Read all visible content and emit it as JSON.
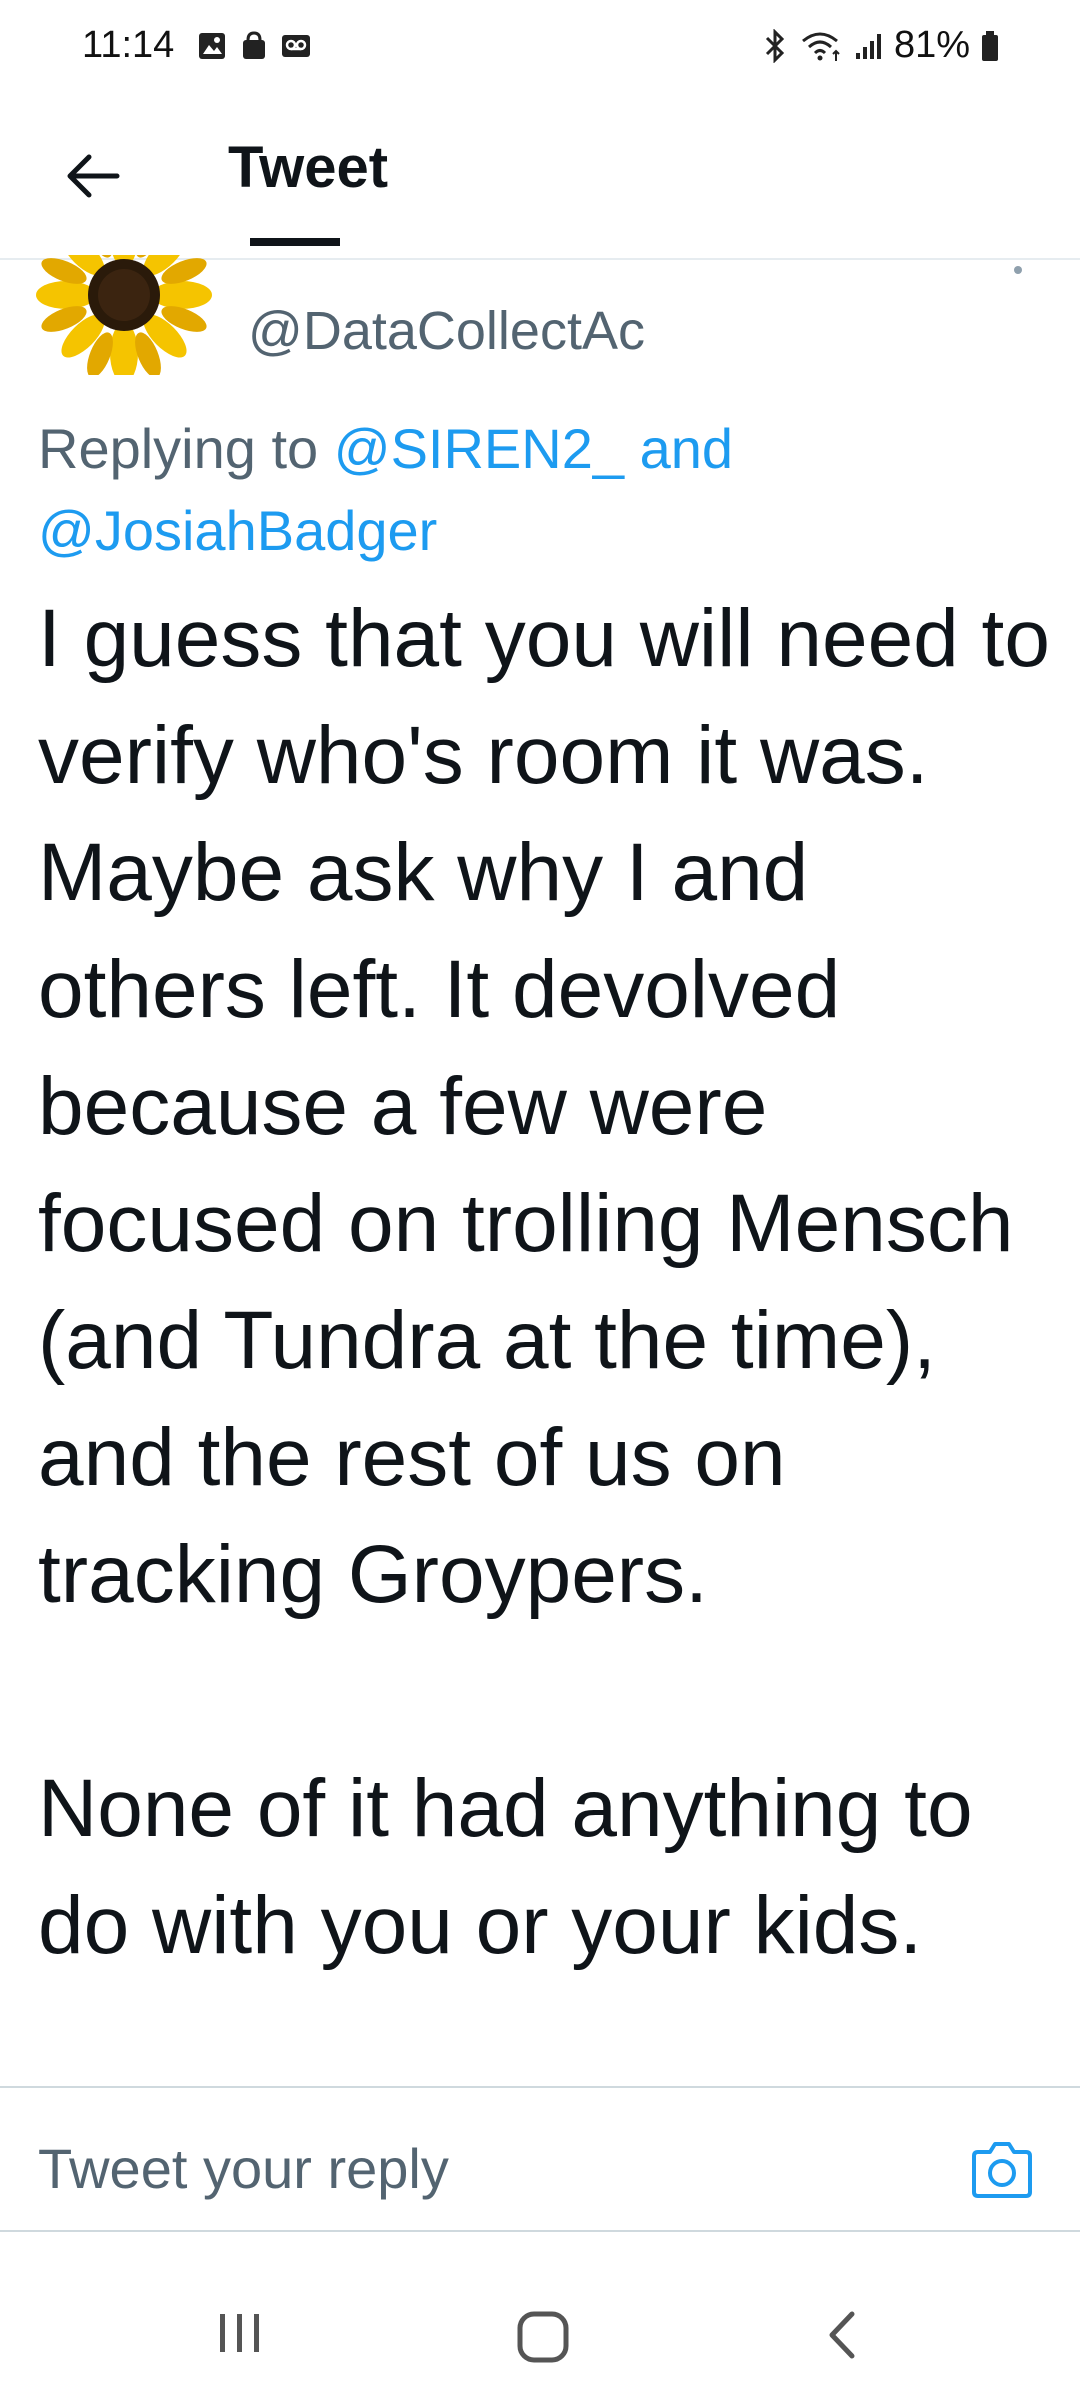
{
  "status_bar": {
    "time": "11:14",
    "battery": "81%"
  },
  "header": {
    "title": "Tweet"
  },
  "tweet": {
    "handle": "@DataCollectAc",
    "replying_prefix": "Replying to ",
    "mention_1": "@SIREN2_",
    "mention_joiner": " and",
    "mention_2": "@JosiahBadger",
    "text": "I guess that you will need to verify who's room it was. Maybe ask why I and others left. It devolved because a few were focused on trolling Mensch (and Tundra at the time), and the rest of us on tracking Groypers.\n\nNone of it had anything to do with you or your kids."
  },
  "reply_bar": {
    "placeholder": "Tweet your reply"
  },
  "icons": {
    "back": "arrow-left-icon",
    "camera": "camera-icon",
    "nav_recents": "recents-icon",
    "nav_home": "home-icon",
    "nav_back": "chevron-left-icon"
  },
  "colors": {
    "accent": "#1d9bf0",
    "secondary_text": "#536471",
    "primary_text": "#0f1419"
  }
}
